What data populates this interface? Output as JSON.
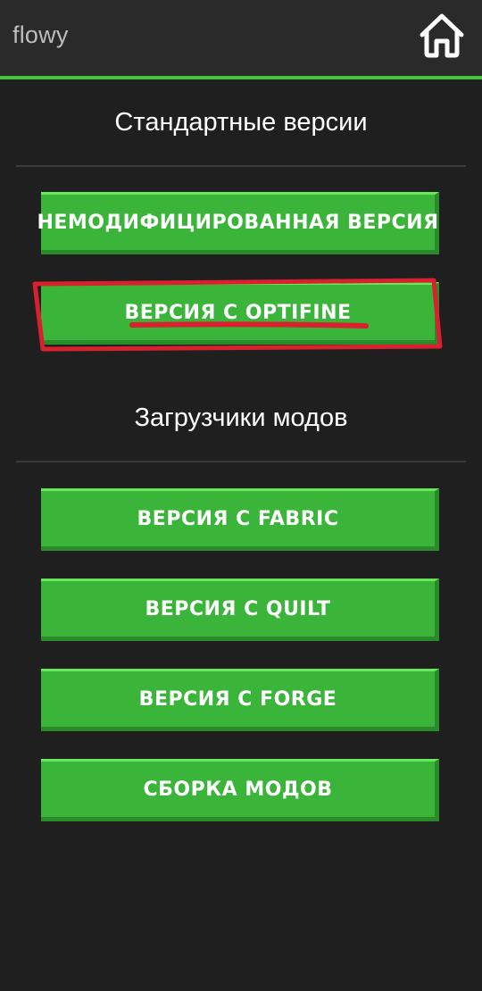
{
  "app": {
    "title": "flowy"
  },
  "header": {
    "home_icon": "home-icon"
  },
  "sections": {
    "standard": {
      "title": "Стандартные версии",
      "buttons": [
        "НЕМОДИФИЦИРОВАННАЯ ВЕРСИЯ",
        "ВЕРСИЯ С OPTIFINE"
      ]
    },
    "loaders": {
      "title": "Загрузчики модов",
      "buttons": [
        "ВЕРСИЯ С FABRIC",
        "ВЕРСИЯ С QUILT",
        "ВЕРСИЯ С FORGE",
        "СБОРКА МОДОВ"
      ]
    }
  },
  "colors": {
    "accent": "#3fc63a",
    "button": "#3bb43a",
    "background": "#1f1f1f",
    "annotation": "#d8202e"
  }
}
